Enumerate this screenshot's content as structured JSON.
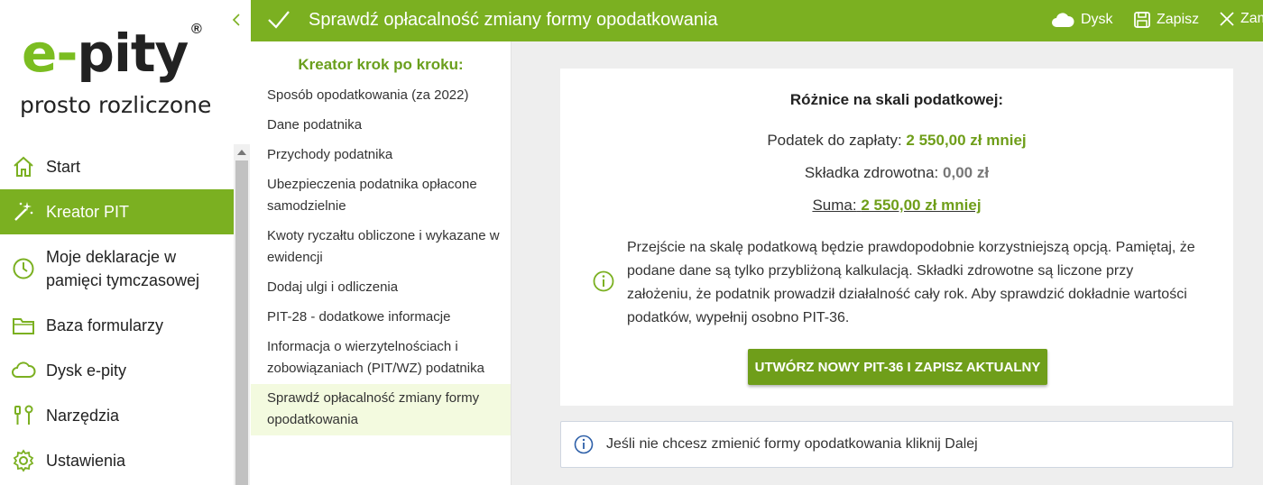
{
  "brand": {
    "logo_e": "e",
    "logo_dot": "-",
    "logo_rest": "pity",
    "logo_reg": "®",
    "tagline": "prosto rozliczone",
    "accent_color": "#7bb021"
  },
  "sidebar": {
    "items": [
      {
        "label": "Start",
        "icon": "home-icon"
      },
      {
        "label": "Kreator PIT",
        "icon": "magic-wand-icon",
        "active": true
      },
      {
        "label": "Moje deklaracje w pamięci tymczasowej",
        "icon": "clock-icon"
      },
      {
        "label": "Baza formularzy",
        "icon": "folder-icon"
      },
      {
        "label": "Dysk e-pity",
        "icon": "cloud-icon"
      },
      {
        "label": "Narzędzia",
        "icon": "tools-icon"
      },
      {
        "label": "Ustawienia",
        "icon": "gear-icon"
      }
    ]
  },
  "header": {
    "title": "Sprawdź opłacalność zmiany formy opodatkowania",
    "dysk_label": "Dysk",
    "save_label": "Zapisz",
    "close_label": "Zamknij"
  },
  "steps": {
    "title": "Kreator krok po kroku:",
    "items": [
      "Sposób opodatkowania (za 2022)",
      "Dane podatnika",
      "Przychody podatnika",
      "Ubezpieczenia podatnika opłacone samodzielnie",
      "Kwoty ryczałtu obliczone i wykazane w ewidencji",
      "Dodaj ulgi i odliczenia",
      "PIT-28 - dodatkowe informacje",
      "Informacja o wierzytelnościach i zobowiązaniach (PIT/WZ) podatnika",
      "Sprawdź opłacalność zmiany formy opodatkowania"
    ]
  },
  "main": {
    "card_title": "Różnice na skali podatkowej:",
    "tax_label": "Podatek do zapłaty:",
    "tax_value": "2 550,00 zł mniej",
    "health_label": "Składka zdrowotna:",
    "health_value": "0,00 zł",
    "sum_label": "Suma:",
    "sum_value": "2 550,00 zł mniej",
    "info_text": "Przejście na skalę podatkową będzie prawdopodobnie korzystniejszą opcją. Pamiętaj, że podane dane są tylko przybliżoną kalkulacją. Składki zdrowotne są liczone przy założeniu, że podatnik prowadził działalność cały rok. Aby sprawdzić dokładnie wartości podatków, wypełnij osobno PIT-36.",
    "cta_label": "UTWÓRZ NOWY PIT-36 I ZAPISZ AKTUALNY",
    "note_text": "Jeśli nie chcesz zmienić formy opodatkowania kliknij Dalej"
  }
}
